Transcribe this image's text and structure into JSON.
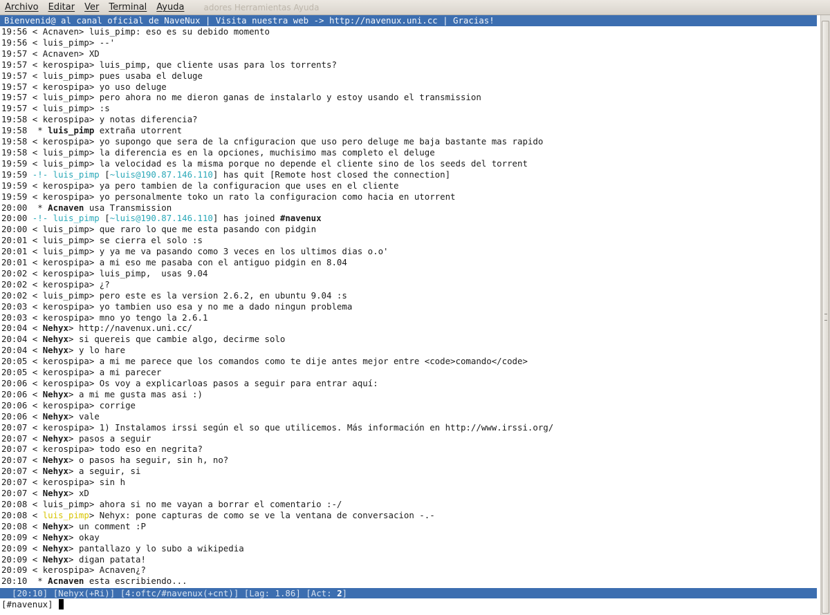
{
  "menubar": {
    "items": [
      "Archivo",
      "Editar",
      "Ver",
      "Terminal",
      "Ayuda"
    ],
    "ghost_text": "adores   Herramientas   Ayuda"
  },
  "topic": "Bienvenid@ al canal oficial de NaveNux | Visita nuestra web -> http://navenux.uni.cc | Gracias!",
  "messages": [
    {
      "type": "msg",
      "time": "19:56",
      "nick": "Acnaven",
      "text": "luis_pimp: eso es su debido momento"
    },
    {
      "type": "msg",
      "time": "19:56",
      "nick": "luis_pimp",
      "text": "--'"
    },
    {
      "type": "msg",
      "time": "19:57",
      "nick": "Acnaven",
      "text": "XD"
    },
    {
      "type": "msg",
      "time": "19:57",
      "nick": "kerospipa",
      "text": "luis_pimp, que cliente usas para los torrents?"
    },
    {
      "type": "msg",
      "time": "19:57",
      "nick": "luis_pimp",
      "text": "pues usaba el deluge"
    },
    {
      "type": "msg",
      "time": "19:57",
      "nick": "kerospipa",
      "text": "yo uso deluge"
    },
    {
      "type": "msg",
      "time": "19:57",
      "nick": "luis_pimp",
      "text": "pero ahora no me dieron ganas de instalarlo y estoy usando el transmission"
    },
    {
      "type": "msg",
      "time": "19:57",
      "nick": "luis_pimp",
      "text": ":s"
    },
    {
      "type": "msg",
      "time": "19:58",
      "nick": "kerospipa",
      "text": "y notas diferencia?"
    },
    {
      "type": "action",
      "time": "19:58",
      "nick": "luis_pimp",
      "text": "extraña utorrent"
    },
    {
      "type": "msg",
      "time": "19:58",
      "nick": "kerospipa",
      "text": "yo supongo que sera de la cnfiguracion que uso pero deluge me baja bastante mas rapido"
    },
    {
      "type": "msg",
      "time": "19:58",
      "nick": "luis_pimp",
      "text": "la diferencia es en la opciones, muchisimo mas completo el deluge"
    },
    {
      "type": "msg",
      "time": "19:59",
      "nick": "luis_pimp",
      "text": "la velocidad es la misma porque no depende el cliente sino de los seeds del torrent"
    },
    {
      "type": "quit",
      "time": "19:59",
      "nick": "luis_pimp",
      "host": "~luis@190.87.146.110",
      "text": "has quit [Remote host closed the connection]"
    },
    {
      "type": "msg",
      "time": "19:59",
      "nick": "kerospipa",
      "text": "ya pero tambien de la configuracion que uses en el cliente"
    },
    {
      "type": "msg",
      "time": "19:59",
      "nick": "kerospipa",
      "text": "yo personalmente toko un rato la configuracion como hacia en utorrent"
    },
    {
      "type": "action",
      "time": "20:00",
      "nick": "Acnaven",
      "text": "usa Transmission"
    },
    {
      "type": "join",
      "time": "20:00",
      "nick": "luis_pimp",
      "host": "~luis@190.87.146.110",
      "text": "has joined",
      "channel": "#navenux"
    },
    {
      "type": "msg",
      "time": "20:00",
      "nick": "luis_pimp",
      "text": "que raro lo que me esta pasando con pidgin"
    },
    {
      "type": "msg",
      "time": "20:01",
      "nick": "luis_pimp",
      "text": "se cierra el solo :s"
    },
    {
      "type": "msg",
      "time": "20:01",
      "nick": "luis_pimp",
      "text": "y ya me va pasando como 3 veces en los ultimos dias o.o'"
    },
    {
      "type": "msg",
      "time": "20:01",
      "nick": "kerospipa",
      "text": "a mi eso me pasaba con el antiguo pidgin en 8.04"
    },
    {
      "type": "msg",
      "time": "20:02",
      "nick": "kerospipa",
      "text": "luis_pimp,  usas 9.04"
    },
    {
      "type": "msg",
      "time": "20:02",
      "nick": "kerospipa",
      "text": "¿?"
    },
    {
      "type": "msg",
      "time": "20:02",
      "nick": "luis_pimp",
      "text": "pero este es la version 2.6.2, en ubuntu 9.04 :s"
    },
    {
      "type": "msg",
      "time": "20:03",
      "nick": "kerospipa",
      "text": "yo tambien uso esa y no me a dado ningun problema"
    },
    {
      "type": "msg",
      "time": "20:03",
      "nick": "kerospipa",
      "text": "mno yo tengo la 2.6.1"
    },
    {
      "type": "msg",
      "time": "20:04",
      "nick": "Nehyx",
      "bold": true,
      "text": "http://navenux.uni.cc/"
    },
    {
      "type": "msg",
      "time": "20:04",
      "nick": "Nehyx",
      "bold": true,
      "text": "si quereis que cambie algo, decirme solo"
    },
    {
      "type": "msg",
      "time": "20:04",
      "nick": "Nehyx",
      "bold": true,
      "text": "y lo hare"
    },
    {
      "type": "msg",
      "time": "20:05",
      "nick": "kerospipa",
      "text": "a mi me parece que los comandos como te dije antes mejor entre <code>comando</code>"
    },
    {
      "type": "msg",
      "time": "20:05",
      "nick": "kerospipa",
      "text": "a mi parecer"
    },
    {
      "type": "msg",
      "time": "20:06",
      "nick": "kerospipa",
      "text": "Os voy a explicarloas pasos a seguir para entrar aquí:"
    },
    {
      "type": "msg",
      "time": "20:06",
      "nick": "Nehyx",
      "bold": true,
      "text": "a mi me gusta mas asi :)"
    },
    {
      "type": "msg",
      "time": "20:06",
      "nick": "kerospipa",
      "text": "corrige"
    },
    {
      "type": "msg",
      "time": "20:06",
      "nick": "Nehyx",
      "bold": true,
      "text": "vale"
    },
    {
      "type": "msg",
      "time": "20:07",
      "nick": "kerospipa",
      "text": "1) Instalamos irssi según el so que utilicemos. Más información en http://www.irssi.org/"
    },
    {
      "type": "msg",
      "time": "20:07",
      "nick": "Nehyx",
      "bold": true,
      "text": "pasos a seguir"
    },
    {
      "type": "msg",
      "time": "20:07",
      "nick": "kerospipa",
      "text": "todo eso en negrita?"
    },
    {
      "type": "msg",
      "time": "20:07",
      "nick": "Nehyx",
      "bold": true,
      "text": "o pasos ha seguir, sin h, no?"
    },
    {
      "type": "msg",
      "time": "20:07",
      "nick": "Nehyx",
      "bold": true,
      "text": "a seguir, si"
    },
    {
      "type": "msg",
      "time": "20:07",
      "nick": "kerospipa",
      "text": "sin h"
    },
    {
      "type": "msg",
      "time": "20:07",
      "nick": "Nehyx",
      "bold": true,
      "text": "xD"
    },
    {
      "type": "msg",
      "time": "20:08",
      "nick": "luis_pimp",
      "text": "ahora si no me vayan a borrar el comentario :-/"
    },
    {
      "type": "msg",
      "time": "20:08",
      "nick": "luis_pimp",
      "yellow": true,
      "text": "Nehyx: pone capturas de como se ve la ventana de conversacion -.-"
    },
    {
      "type": "msg",
      "time": "20:08",
      "nick": "Nehyx",
      "bold": true,
      "text": "un comment :P"
    },
    {
      "type": "msg",
      "time": "20:09",
      "nick": "Nehyx",
      "bold": true,
      "text": "okay"
    },
    {
      "type": "msg",
      "time": "20:09",
      "nick": "Nehyx",
      "bold": true,
      "text": "pantallazo y lo subo a wikipedia"
    },
    {
      "type": "msg",
      "time": "20:09",
      "nick": "Nehyx",
      "bold": true,
      "text": "digan patata!"
    },
    {
      "type": "msg",
      "time": "20:09",
      "nick": "kerospipa",
      "text": "Acnaven¿?"
    },
    {
      "type": "action",
      "time": "20:10",
      "nick": "Acnaven",
      "text": "esta escribiendo..."
    }
  ],
  "status": {
    "time": "20:10",
    "user": "Nehyx(+Ri)",
    "window": "4:oftc/#navenux(+cnt)",
    "lag": "Lag: 1.86",
    "act_label": "Act:",
    "act_count": "2"
  },
  "input": {
    "prompt": "[#navenux]"
  },
  "colors": {
    "bar": "#3c6eb0",
    "join_quit": "#2aa8b8",
    "highlight_nick": "#d7c400"
  }
}
